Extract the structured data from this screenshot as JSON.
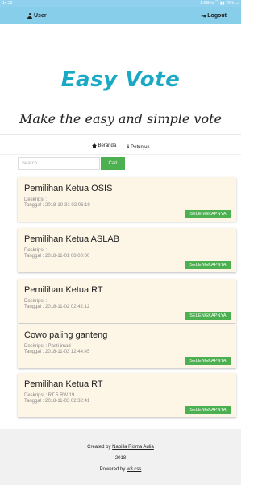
{
  "statusbar": {
    "time": "14:32",
    "right": "1.69K/s ⌒ ▮▮ 70% ▭"
  },
  "topbar": {
    "user_label": "User",
    "logout_label": "Logout"
  },
  "branding": {
    "logo": "Easy Vote",
    "tagline": "Make the easy and simple vote"
  },
  "nav": {
    "home_label": "Beranda",
    "help_label": "Petunjuk"
  },
  "search": {
    "placeholder": "Search..",
    "button_label": "Cari"
  },
  "more_label": "SELENGKAPNYA",
  "polls": [
    {
      "title": "Pemilihan Ketua OSIS",
      "deskripsi": "Deskripsi :",
      "tanggal": "Tanggal : 2018-10-31 02:06:19"
    },
    {
      "title": "Pemilihan Ketua ASLAB",
      "deskripsi": "Deskripsi :",
      "tanggal": "Tanggal : 2018-11-01 08:00:00"
    },
    {
      "title": "Pemilihan Ketua RT",
      "deskripsi": "Deskripsi :",
      "tanggal": "Tanggal : 2018-11-02 02:42:12"
    },
    {
      "title": "Cowo paling ganteng",
      "deskripsi": "Deskripsi : Pasti imad",
      "tanggal": "Tanggal : 2018-11-03 12:44:45"
    },
    {
      "title": "Pemilihan Ketua RT",
      "deskripsi": "Deskripsi : RT 5 RW 19",
      "tanggal": "Tanggal : 2018-11-03 02:32:41"
    }
  ],
  "footer": {
    "created_prefix": "Created by ",
    "author": "Nabilla Risma Aulia",
    "year": "2018",
    "powered_prefix": "Powered by ",
    "powered_link": "w3.css"
  },
  "colors": {
    "topbar": "#87ceeb",
    "logo": "#1aa9c5",
    "accent_green": "#4caf50",
    "card_bg": "#fdf5e6",
    "footer_bg": "#f1f1f1"
  }
}
